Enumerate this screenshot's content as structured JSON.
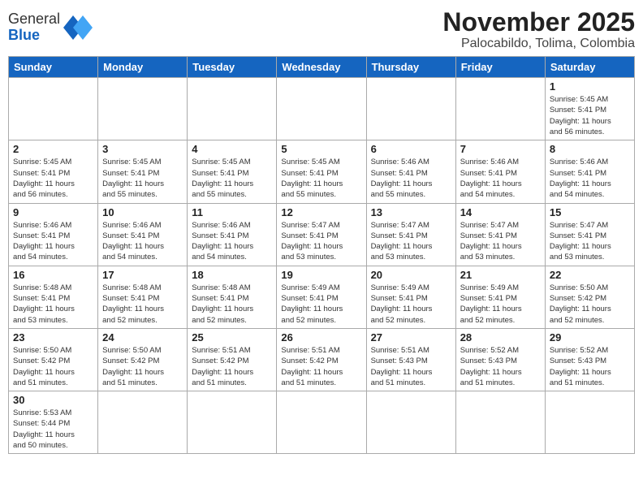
{
  "header": {
    "logo_general": "General",
    "logo_blue": "Blue",
    "month_title": "November 2025",
    "location": "Palocabildo, Tolima, Colombia"
  },
  "weekdays": [
    "Sunday",
    "Monday",
    "Tuesday",
    "Wednesday",
    "Thursday",
    "Friday",
    "Saturday"
  ],
  "weeks": [
    [
      {
        "day": "",
        "info": ""
      },
      {
        "day": "",
        "info": ""
      },
      {
        "day": "",
        "info": ""
      },
      {
        "day": "",
        "info": ""
      },
      {
        "day": "",
        "info": ""
      },
      {
        "day": "",
        "info": ""
      },
      {
        "day": "1",
        "info": "Sunrise: 5:45 AM\nSunset: 5:41 PM\nDaylight: 11 hours\nand 56 minutes."
      }
    ],
    [
      {
        "day": "2",
        "info": "Sunrise: 5:45 AM\nSunset: 5:41 PM\nDaylight: 11 hours\nand 56 minutes."
      },
      {
        "day": "3",
        "info": "Sunrise: 5:45 AM\nSunset: 5:41 PM\nDaylight: 11 hours\nand 55 minutes."
      },
      {
        "day": "4",
        "info": "Sunrise: 5:45 AM\nSunset: 5:41 PM\nDaylight: 11 hours\nand 55 minutes."
      },
      {
        "day": "5",
        "info": "Sunrise: 5:45 AM\nSunset: 5:41 PM\nDaylight: 11 hours\nand 55 minutes."
      },
      {
        "day": "6",
        "info": "Sunrise: 5:46 AM\nSunset: 5:41 PM\nDaylight: 11 hours\nand 55 minutes."
      },
      {
        "day": "7",
        "info": "Sunrise: 5:46 AM\nSunset: 5:41 PM\nDaylight: 11 hours\nand 54 minutes."
      },
      {
        "day": "8",
        "info": "Sunrise: 5:46 AM\nSunset: 5:41 PM\nDaylight: 11 hours\nand 54 minutes."
      }
    ],
    [
      {
        "day": "9",
        "info": "Sunrise: 5:46 AM\nSunset: 5:41 PM\nDaylight: 11 hours\nand 54 minutes."
      },
      {
        "day": "10",
        "info": "Sunrise: 5:46 AM\nSunset: 5:41 PM\nDaylight: 11 hours\nand 54 minutes."
      },
      {
        "day": "11",
        "info": "Sunrise: 5:46 AM\nSunset: 5:41 PM\nDaylight: 11 hours\nand 54 minutes."
      },
      {
        "day": "12",
        "info": "Sunrise: 5:47 AM\nSunset: 5:41 PM\nDaylight: 11 hours\nand 53 minutes."
      },
      {
        "day": "13",
        "info": "Sunrise: 5:47 AM\nSunset: 5:41 PM\nDaylight: 11 hours\nand 53 minutes."
      },
      {
        "day": "14",
        "info": "Sunrise: 5:47 AM\nSunset: 5:41 PM\nDaylight: 11 hours\nand 53 minutes."
      },
      {
        "day": "15",
        "info": "Sunrise: 5:47 AM\nSunset: 5:41 PM\nDaylight: 11 hours\nand 53 minutes."
      }
    ],
    [
      {
        "day": "16",
        "info": "Sunrise: 5:48 AM\nSunset: 5:41 PM\nDaylight: 11 hours\nand 53 minutes."
      },
      {
        "day": "17",
        "info": "Sunrise: 5:48 AM\nSunset: 5:41 PM\nDaylight: 11 hours\nand 52 minutes."
      },
      {
        "day": "18",
        "info": "Sunrise: 5:48 AM\nSunset: 5:41 PM\nDaylight: 11 hours\nand 52 minutes."
      },
      {
        "day": "19",
        "info": "Sunrise: 5:49 AM\nSunset: 5:41 PM\nDaylight: 11 hours\nand 52 minutes."
      },
      {
        "day": "20",
        "info": "Sunrise: 5:49 AM\nSunset: 5:41 PM\nDaylight: 11 hours\nand 52 minutes."
      },
      {
        "day": "21",
        "info": "Sunrise: 5:49 AM\nSunset: 5:41 PM\nDaylight: 11 hours\nand 52 minutes."
      },
      {
        "day": "22",
        "info": "Sunrise: 5:50 AM\nSunset: 5:42 PM\nDaylight: 11 hours\nand 52 minutes."
      }
    ],
    [
      {
        "day": "23",
        "info": "Sunrise: 5:50 AM\nSunset: 5:42 PM\nDaylight: 11 hours\nand 51 minutes."
      },
      {
        "day": "24",
        "info": "Sunrise: 5:50 AM\nSunset: 5:42 PM\nDaylight: 11 hours\nand 51 minutes."
      },
      {
        "day": "25",
        "info": "Sunrise: 5:51 AM\nSunset: 5:42 PM\nDaylight: 11 hours\nand 51 minutes."
      },
      {
        "day": "26",
        "info": "Sunrise: 5:51 AM\nSunset: 5:42 PM\nDaylight: 11 hours\nand 51 minutes."
      },
      {
        "day": "27",
        "info": "Sunrise: 5:51 AM\nSunset: 5:43 PM\nDaylight: 11 hours\nand 51 minutes."
      },
      {
        "day": "28",
        "info": "Sunrise: 5:52 AM\nSunset: 5:43 PM\nDaylight: 11 hours\nand 51 minutes."
      },
      {
        "day": "29",
        "info": "Sunrise: 5:52 AM\nSunset: 5:43 PM\nDaylight: 11 hours\nand 51 minutes."
      }
    ],
    [
      {
        "day": "30",
        "info": "Sunrise: 5:53 AM\nSunset: 5:44 PM\nDaylight: 11 hours\nand 50 minutes."
      },
      {
        "day": "",
        "info": ""
      },
      {
        "day": "",
        "info": ""
      },
      {
        "day": "",
        "info": ""
      },
      {
        "day": "",
        "info": ""
      },
      {
        "day": "",
        "info": ""
      },
      {
        "day": "",
        "info": ""
      }
    ]
  ]
}
